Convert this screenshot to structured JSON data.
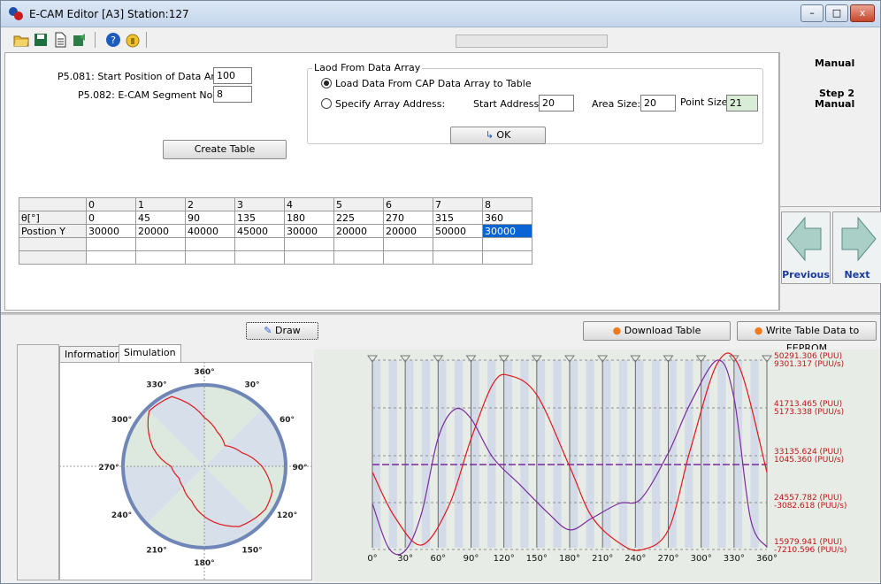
{
  "window": {
    "title": "E-CAM Editor [A3] Station:127",
    "minimize": "–",
    "maximize": "□",
    "close": "x"
  },
  "toolbar": {
    "icons": [
      "open-folder-icon",
      "save-icon",
      "document-icon",
      "export-icon",
      "help-icon",
      "lock-icon"
    ]
  },
  "form": {
    "start_pos_label": "P5.081: Start Position of Data Array",
    "start_pos_value": "100",
    "segment_label": "P5.082: E-CAM Segment No.",
    "segment_value": "8",
    "create_table": "Create Table"
  },
  "load_group": {
    "title": "Laod From Data Array",
    "option1": "Load Data From CAP Data Array to Table",
    "option2": "Specify Array Address:",
    "start_addr_label": "Start Address:",
    "start_addr_value": "20",
    "area_size_label": "Area Size:",
    "area_size_value": "20",
    "point_size_label": "Point Size:",
    "point_size_value": "21",
    "ok_label": "OK"
  },
  "side": {
    "mode": "Manual",
    "step_line1": "Step 2",
    "step_line2": "Manual",
    "prev": "Previous",
    "next": "Next"
  },
  "table": {
    "headers": [
      "",
      "0",
      "1",
      "2",
      "3",
      "4",
      "5",
      "6",
      "7",
      "8"
    ],
    "rows": [
      [
        "θ[°]",
        "0",
        "45",
        "90",
        "135",
        "180",
        "225",
        "270",
        "315",
        "360"
      ],
      [
        "Postion Y",
        "30000",
        "20000",
        "40000",
        "45000",
        "30000",
        "20000",
        "20000",
        "50000",
        "30000"
      ],
      [
        "",
        "",
        "",
        "",
        "",
        "",
        "",
        "",
        "",
        ""
      ],
      [
        "",
        "",
        "",
        "",
        "",
        "",
        "",
        "",
        "",
        ""
      ]
    ]
  },
  "actions": {
    "draw": "Draw",
    "download": "Download Table",
    "write_eeprom": "Write Table Data to EEPROM"
  },
  "tabs": [
    "Information",
    "Simulation"
  ],
  "polar": {
    "labels": [
      "360°",
      "30°",
      "60°",
      "90°",
      "120°",
      "150°",
      "180°",
      "210°",
      "240°",
      "270°",
      "300°",
      "330°"
    ]
  },
  "chart_data": {
    "type": "line",
    "x_ticks": [
      "0°",
      "30°",
      "60°",
      "90°",
      "120°",
      "150°",
      "180°",
      "210°",
      "240°",
      "270°",
      "300°",
      "330°",
      "360°"
    ],
    "xlim": [
      0,
      360
    ],
    "colors": {
      "position": "#e0181b",
      "velocity": "#7a2a9c",
      "axis_line": "#7a2a9c"
    },
    "series": [
      {
        "x": [
          0,
          20,
          45,
          70,
          90,
          110,
          125,
          150,
          180,
          200,
          225,
          245,
          270,
          290,
          315,
          335,
          360
        ],
        "y": [
          30000,
          22000,
          16800,
          24000,
          36000,
          46000,
          47500,
          44000,
          31000,
          22000,
          17200,
          15900,
          19500,
          34000,
          49800,
          49000,
          30000
        ]
      },
      {
        "x": [
          0,
          15,
          30,
          45,
          60,
          75,
          90,
          110,
          135,
          160,
          180,
          200,
          225,
          245,
          270,
          290,
          315,
          330,
          345,
          360
        ],
        "y": [
          -3200,
          -7100,
          -7300,
          -4000,
          2500,
          5000,
          4200,
          800,
          -1600,
          -4000,
          -5500,
          -4500,
          -3200,
          -2800,
          1200,
          5500,
          9300,
          6000,
          -4500,
          -7000
        ]
      }
    ],
    "right_labels": [
      {
        "pos": "50291.306  (PUU)",
        "vel": "9301.317  (PUU/s)"
      },
      {
        "pos": "41713.465  (PUU)",
        "vel": "5173.338  (PUU/s)"
      },
      {
        "pos": "33135.624  (PUU)",
        "vel": "1045.360  (PUU/s)"
      },
      {
        "pos": "24557.782  (PUU)",
        "vel": "-3082.618  (PUU/s)"
      },
      {
        "pos": "15979.941  (PUU)",
        "vel": "-7210.596  (PUU/s)"
      }
    ]
  }
}
